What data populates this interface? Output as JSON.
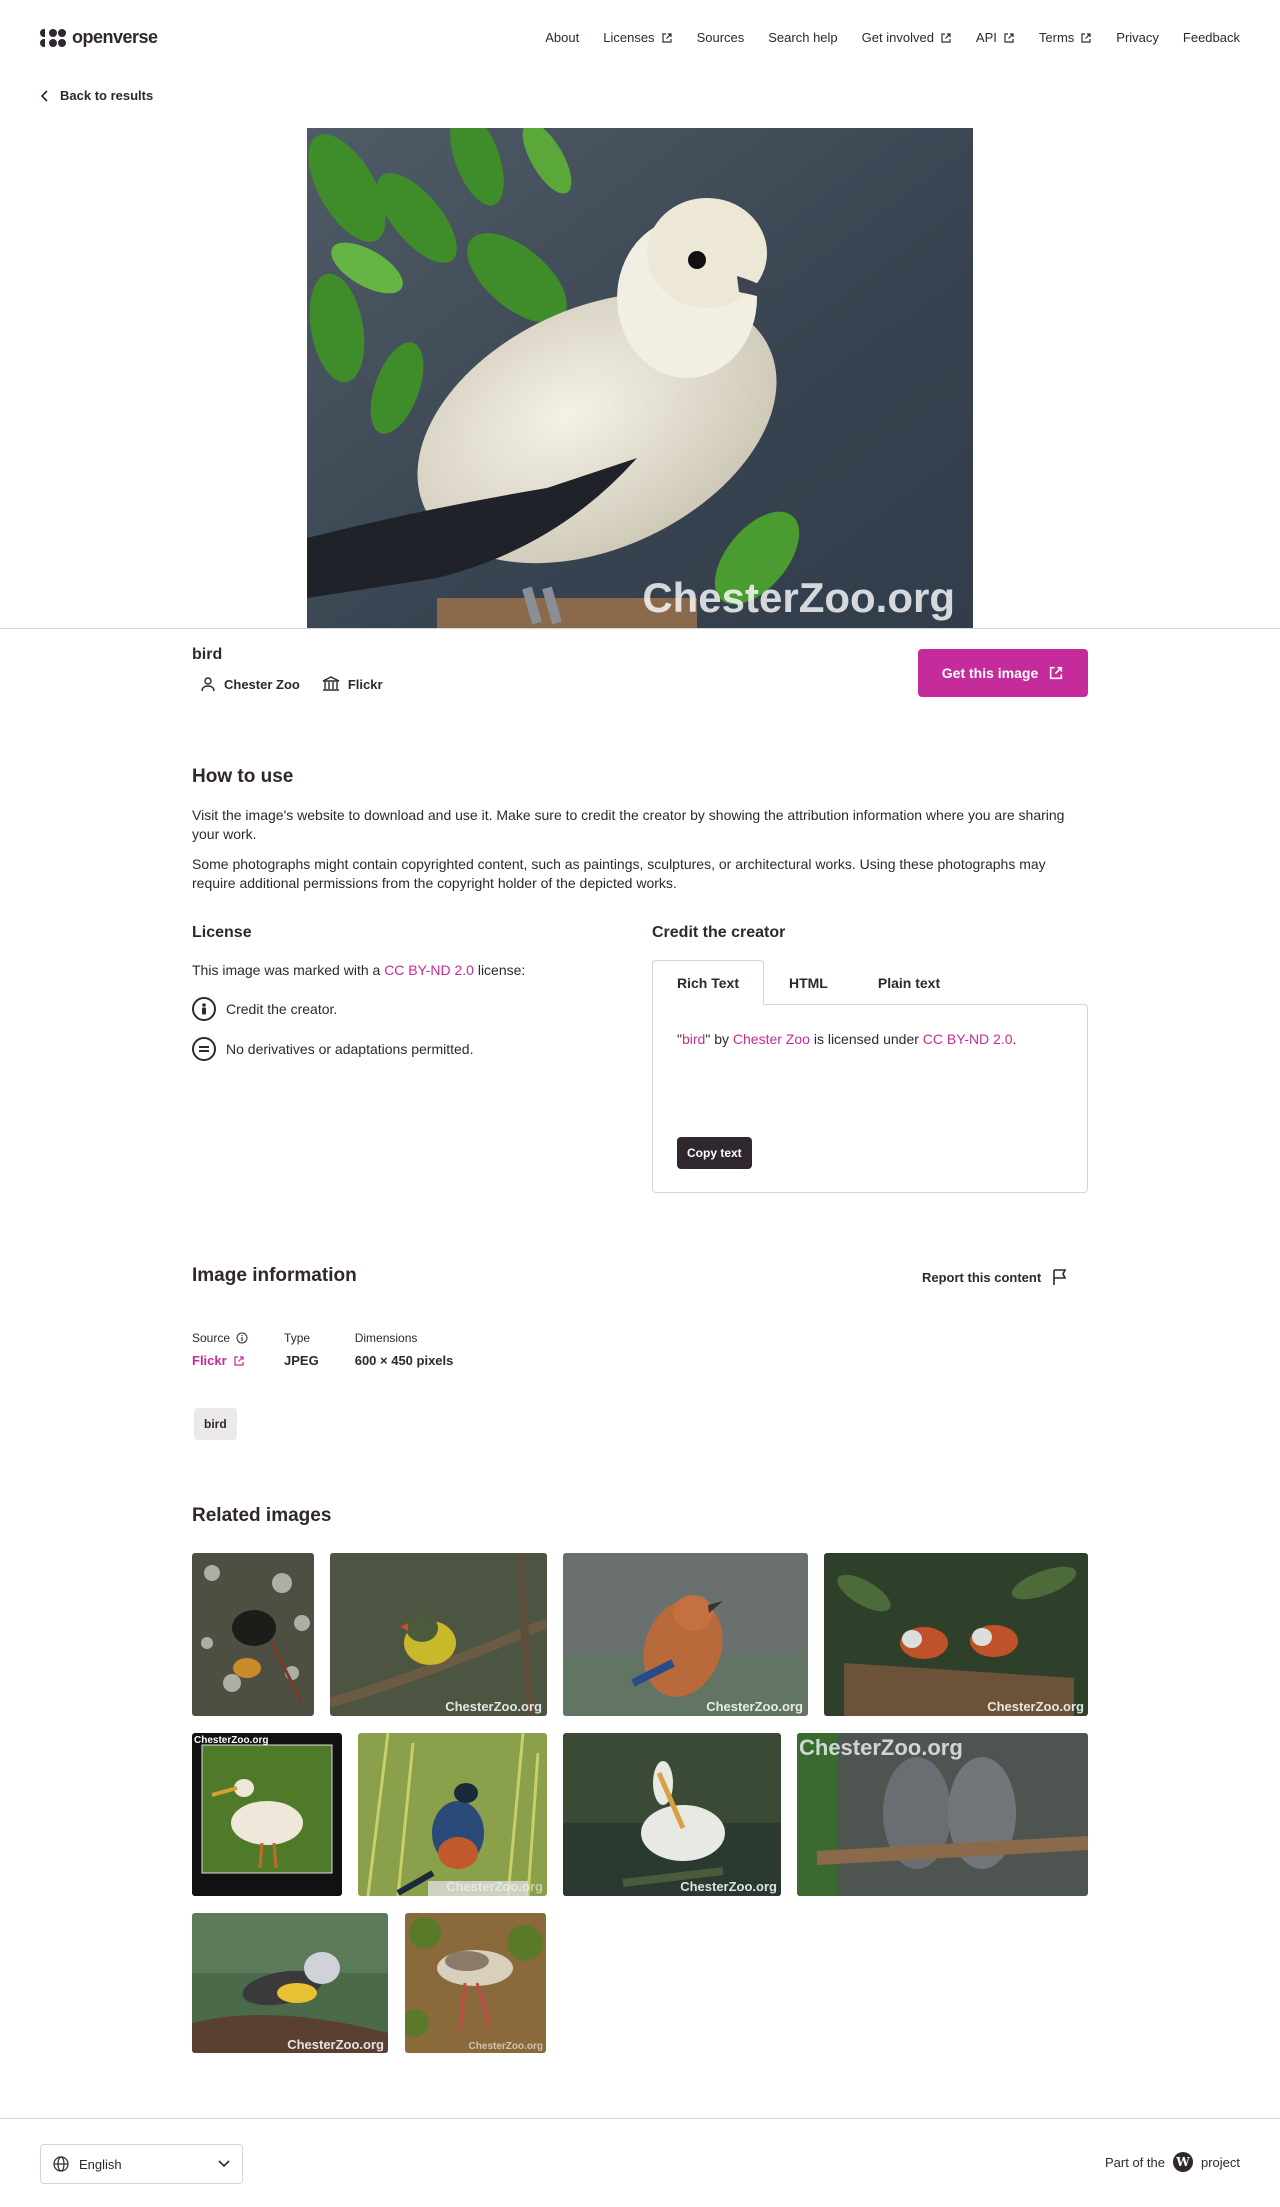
{
  "header": {
    "logo_text": "openverse",
    "nav": [
      {
        "label": "About",
        "external": false
      },
      {
        "label": "Licenses",
        "external": true
      },
      {
        "label": "Sources",
        "external": false
      },
      {
        "label": "Search help",
        "external": false
      },
      {
        "label": "Get involved",
        "external": true
      },
      {
        "label": "API",
        "external": true
      },
      {
        "label": "Terms",
        "external": true
      },
      {
        "label": "Privacy",
        "external": false
      },
      {
        "label": "Feedback",
        "external": false
      }
    ]
  },
  "back_link": "Back to results",
  "hero": {
    "watermark": "ChesterZoo.org"
  },
  "image": {
    "title": "bird",
    "creator": "Chester Zoo",
    "source": "Flickr",
    "get_button": "Get this image"
  },
  "how_to_use": {
    "title": "How to use",
    "paragraph1": "Visit the image's website to download and use it. Make sure to credit the creator by showing the attribution information where you are sharing your work.",
    "paragraph2": "Some photographs might contain copyrighted content, such as paintings, sculptures, or architectural works. Using these photographs may require additional permissions from the copyright holder of the depicted works."
  },
  "license": {
    "title": "License",
    "intro_before": "This image was marked with a ",
    "license_name": "CC BY-ND 2.0",
    "intro_after": " license:",
    "items": [
      "Credit the creator.",
      "No derivatives or adaptations permitted."
    ]
  },
  "credit": {
    "title": "Credit the creator",
    "tabs": [
      "Rich Text",
      "HTML",
      "Plain text"
    ],
    "active_tab": "Rich Text",
    "quote_open": "\"",
    "work_title": "bird",
    "quote_close": "\" by ",
    "creator": "Chester Zoo",
    "mid": " is licensed under ",
    "license": "CC BY-ND 2.0",
    "end": ".",
    "copy_button": "Copy text"
  },
  "image_info": {
    "title": "Image information",
    "report": "Report this content",
    "source_label": "Source",
    "source_value": "Flickr",
    "type_label": "Type",
    "type_value": "JPEG",
    "dimensions_label": "Dimensions",
    "dimensions_value": "600 × 450 pixels",
    "tag": "bird"
  },
  "related": {
    "title": "Related images",
    "watermark": "ChesterZoo.org"
  },
  "footer": {
    "language": "English",
    "part_of_before": "Part of the",
    "part_of_after": "project"
  },
  "colors": {
    "accent": "#c52b9b",
    "text": "#30272e",
    "border": "#d8d4d6"
  }
}
